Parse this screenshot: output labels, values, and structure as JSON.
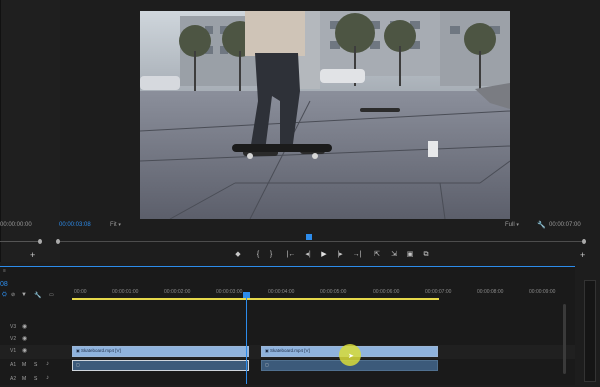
{
  "source_monitor": {
    "timecode_left": "00:00:00:00"
  },
  "program_monitor": {
    "timecode_current": "00:00:03:08",
    "zoom": "Fit",
    "resolution": "Full",
    "timecode_duration": "00:00:07:00",
    "playhead_fraction": 0.44
  },
  "transport": {
    "marker": "◆",
    "in": "{",
    "out": "}",
    "go_in": "|←",
    "step_back": "◂|",
    "play": "▶",
    "step_fwd": "|▸",
    "go_out": "→|",
    "lift": "⇱",
    "extract": "⇲",
    "export_frame": "▣",
    "compare": "⧉",
    "plus": "+"
  },
  "timeline": {
    "timecode": "08",
    "ruler": [
      "00:00",
      "00:00:01:00",
      "00:00:02:00",
      "00:00:03:00",
      "00:00:04:00",
      "00:00:05:00",
      "00:00:06:00",
      "00:00:07:00",
      "00:00:08:00",
      "00:00:09:00"
    ],
    "tracks": [
      {
        "label": "V3"
      },
      {
        "label": "V2"
      },
      {
        "label": "V1"
      },
      {
        "label": "A1"
      },
      {
        "label": "A2"
      }
    ],
    "clips": [
      {
        "name": "Skateboard.mp4 [V]"
      },
      {
        "name": "Skateboard.mp4 [V]"
      }
    ]
  },
  "colors": {
    "accent": "#2d8ceb",
    "clip_video": "#8fb3dd",
    "clip_audio": "#3c5a7a",
    "work_area": "#e6d84b",
    "cursor": "#d8dc3a"
  }
}
